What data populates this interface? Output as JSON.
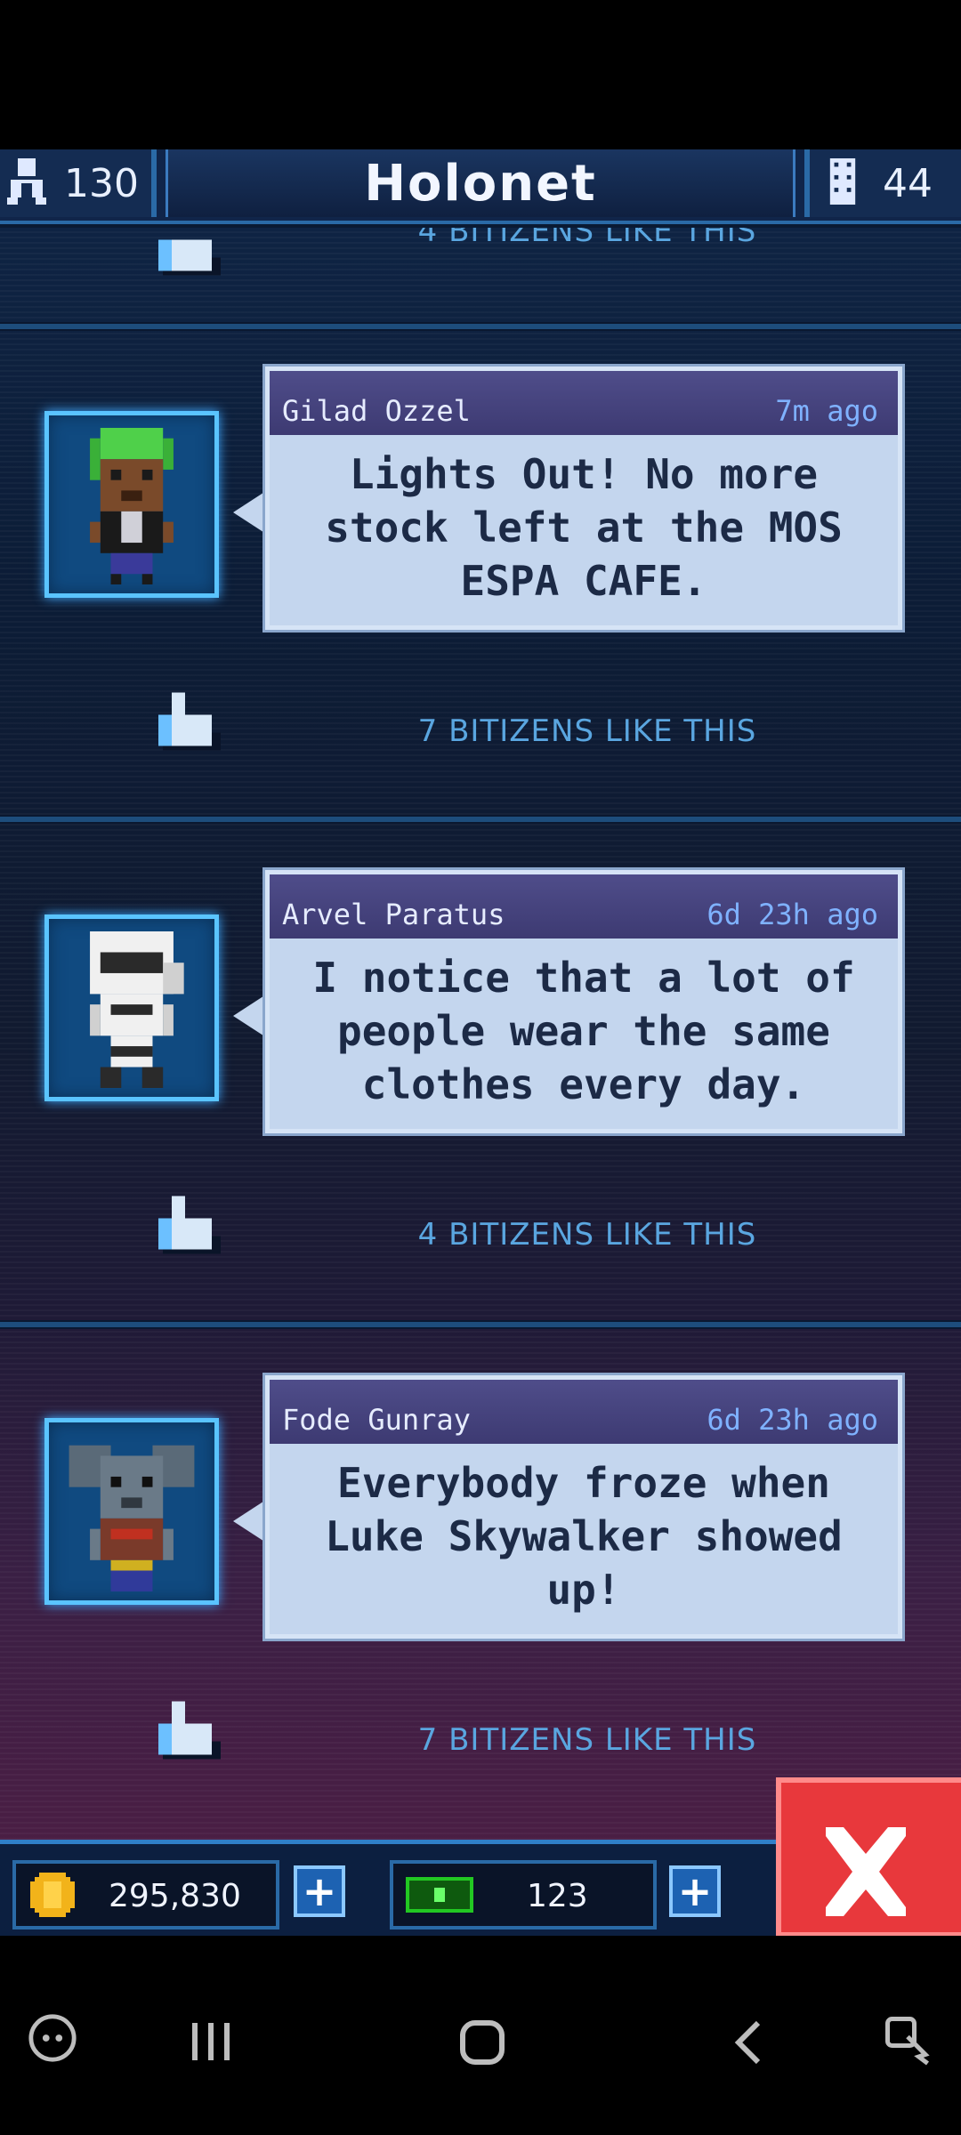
{
  "header": {
    "title": "Holonet",
    "population": "130",
    "floors": "44"
  },
  "partial_likes": "4 BITIZENS LIKE THIS",
  "posts": [
    {
      "name": "Gilad Ozzel",
      "time": "7m ago",
      "message": "Lights Out! No more stock left at the MOS ESPA CAFE.",
      "likes": "7 BITIZENS LIKE THIS"
    },
    {
      "name": "Arvel Paratus",
      "time": "6d 23h ago",
      "message": "I notice that a lot of people wear the same clothes every day.",
      "likes": "4 BITIZENS LIKE THIS"
    },
    {
      "name": "Fode Gunray",
      "time": "6d 23h ago",
      "message": "Everybody froze when Luke Skywalker showed up!",
      "likes": "7 BITIZENS LIKE THIS"
    }
  ],
  "footer": {
    "coins": "295,830",
    "bux": "123"
  },
  "colors": {
    "accent": "#2a6aa6",
    "glow": "#5ac4ff",
    "bubble": "#c4d6ee",
    "close": "#e8383c"
  },
  "icons": [
    "person-icon",
    "building-icon",
    "thumbs-up-icon",
    "coin-icon",
    "bux-icon",
    "plus-icon",
    "close-icon",
    "game-launcher-icon",
    "recent-apps-icon",
    "home-icon",
    "back-icon",
    "accessibility-icon"
  ]
}
